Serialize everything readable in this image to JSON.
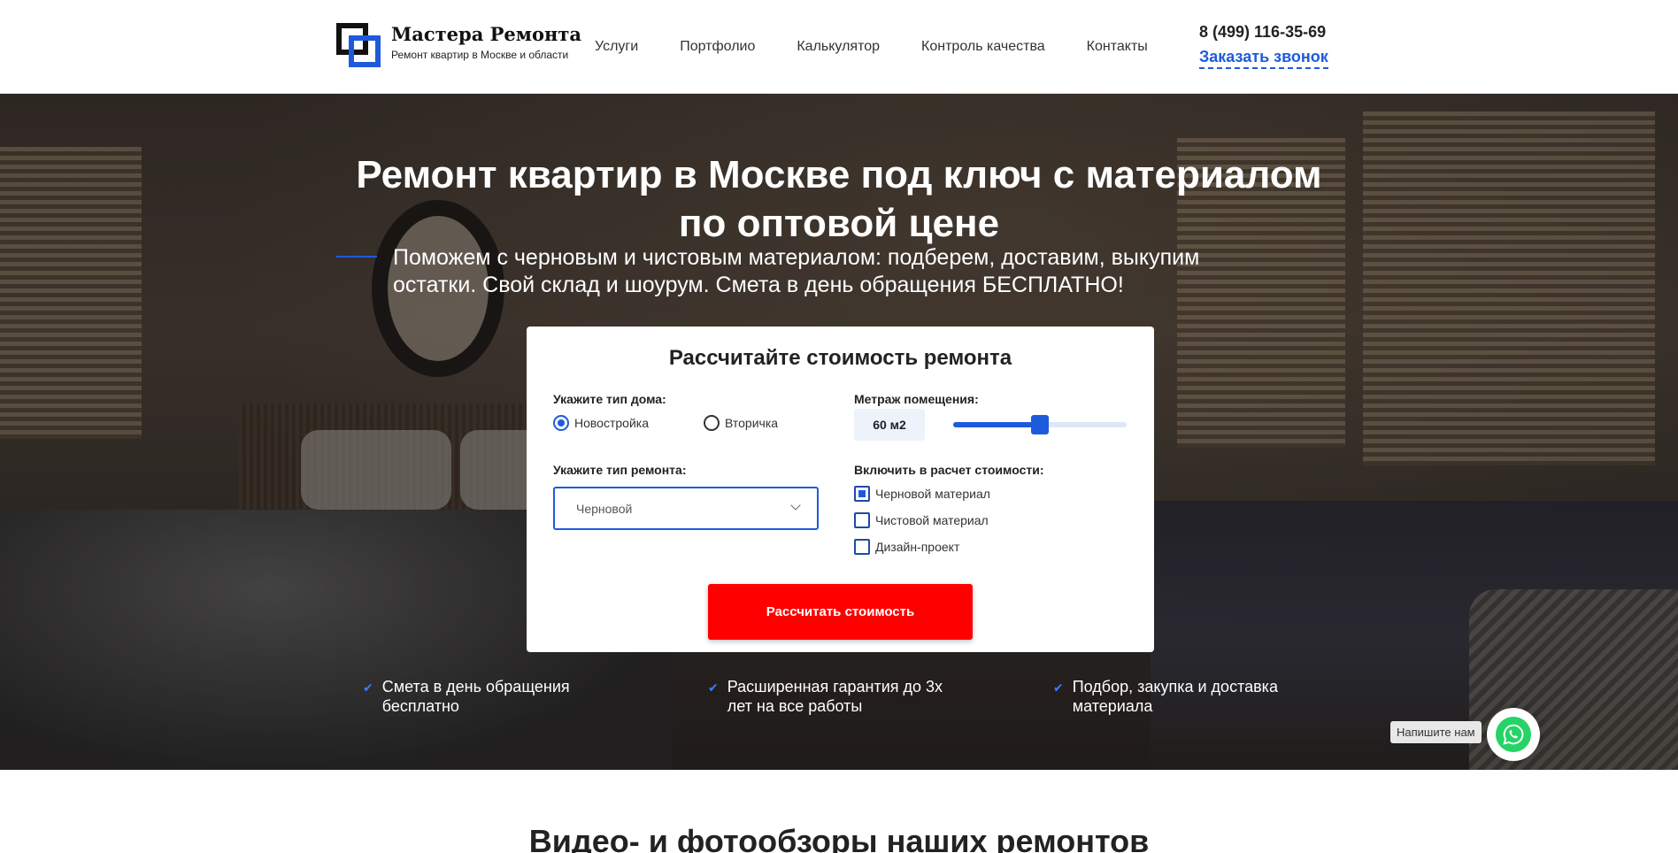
{
  "brand": {
    "name": "Мастера Ремонта",
    "tagline": "Ремонт квартир в Москве и области",
    "colors": {
      "accent": "#1e5bdc",
      "cta": "#ff0000",
      "whatsapp": "#25d366"
    }
  },
  "nav": {
    "items": [
      {
        "label": "Услуги"
      },
      {
        "label": "Портфолио"
      },
      {
        "label": "Калькулятор"
      },
      {
        "label": "Контроль качества"
      },
      {
        "label": "Контакты"
      }
    ]
  },
  "contact": {
    "phone": "8 (499) 116-35-69",
    "callback_label": "Заказать звонок"
  },
  "hero": {
    "title_line1": "Ремонт квартир в Москве под ключ с материалом",
    "title_line2": "по оптовой цене",
    "subtitle_line1": "Поможем с черновым и чистовым материалом: подберем, доставим, выкупим",
    "subtitle_line2": "остатки. Свой склад и шоурум. Смета в день обращения БЕСПЛАТНО!"
  },
  "calculator": {
    "title": "Рассчитайте стоимость ремонта",
    "house_type": {
      "label": "Укажите тип дома:",
      "options": [
        {
          "label": "Новостройка",
          "selected": true
        },
        {
          "label": "Вторичка",
          "selected": false
        }
      ]
    },
    "area": {
      "label": "Метраж помещения:",
      "value_text": "60 м2",
      "slider_fraction": 0.5
    },
    "repair_type": {
      "label": "Укажите тип ремонта:",
      "selected": "Черновой"
    },
    "include": {
      "label": "Включить в расчет стоимости:",
      "options": [
        {
          "label": "Черновой материал",
          "checked": true
        },
        {
          "label": "Чистовой материал",
          "checked": false
        },
        {
          "label": "Дизайн-проект",
          "checked": false
        }
      ]
    },
    "submit_label": "Рассчитать стоимость"
  },
  "features": [
    {
      "line1": "Смета в день обращения",
      "line2": "бесплатно"
    },
    {
      "line1": "Расширенная гарантия до 3х",
      "line2": "лет на все работы"
    },
    {
      "line1": "Подбор, закупка и доставка",
      "line2": "материала"
    }
  ],
  "whatsapp": {
    "label": "Напишите нам",
    "icon": "whatsapp-icon"
  },
  "next_section": {
    "title": "Видео- и фотообзоры наших ремонтов"
  }
}
